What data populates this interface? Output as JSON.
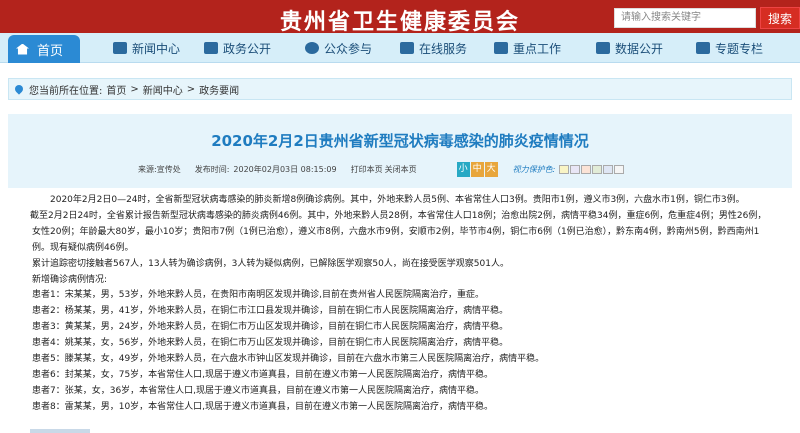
{
  "header": {
    "site_title": "贵州省卫生健康委员会",
    "search_placeholder": "请输入搜索关键字",
    "search_button": "搜索"
  },
  "nav": {
    "items": [
      {
        "label": "首页",
        "icon": "home-icon"
      },
      {
        "label": "新闻中心",
        "icon": "news-icon"
      },
      {
        "label": "政务公开",
        "icon": "briefcase-icon"
      },
      {
        "label": "公众参与",
        "icon": "chat-icon"
      },
      {
        "label": "在线服务",
        "icon": "monitor-icon"
      },
      {
        "label": "重点工作",
        "icon": "bookmark-icon"
      },
      {
        "label": "数据公开",
        "icon": "data-icon"
      },
      {
        "label": "专题专栏",
        "icon": "topic-icon"
      }
    ]
  },
  "breadcrumb": {
    "prefix": "您当前所在位置:",
    "items": [
      "首页",
      "新闻中心",
      "政务要闻"
    ],
    "separator": ">"
  },
  "article": {
    "title": "2020年2月2日贵州省新型冠状病毒感染的肺炎疫情情况",
    "source": "来源:宣传处",
    "published": "发布时间:",
    "published_value": "2020年02月03日 08:15:09",
    "print_label": "打印本页",
    "close_label": "关闭本页",
    "font_sizes": [
      "小",
      "中",
      "大"
    ],
    "font_size_colors": [
      "#28a9c4",
      "#e8a63c",
      "#e8a63c"
    ],
    "vision_label": "视力保护色:",
    "vision_colors": [
      "#f9f4c5",
      "#e9e6f6",
      "#fbe3d6",
      "#e2ecd7",
      "#dfe6f4",
      "#f5f5f5"
    ],
    "paragraphs": [
      "2020年2月2日0—24时，全省新型冠状病毒感染的肺炎新增8例确诊病例。其中，外地来黔人员5例、本省常住人口3例。贵阳市1例，遵义市3例，六盘水市1例，铜仁市3例。",
      "截至2月2日24时，全省累计报告新型冠状病毒感染的肺炎病例46例。其中，外地来黔人员28例，本省常住人口18例；治愈出院2例，病情平稳34例，重症6例，危重症4例；男性26例，女性20例；年龄最大80岁，最小10岁；贵阳市7例（1例已治愈），遵义市8例，六盘水市9例，安顺市2例，毕节市4例，铜仁市6例（1例已治愈），黔东南4例，黔南州5例，黔西南州1例。现有疑似病例46例。",
      "累计追踪密切接触者567人，13人转为确诊病例，3人转为疑似病例，已解除医学观察50人，尚在接受医学观察501人。",
      "新增确诊病例情况:",
      "患者1：宋某某，男，53岁，外地来黔人员，在贵阳市南明区发现并确诊,目前在贵州省人民医院隔离治疗，重症。",
      "患者2：杨某某，男，41岁，外地来黔人员，在铜仁市江口县发现并确诊，目前在铜仁市人民医院隔离治疗，病情平稳。",
      "患者3：黄某某，男，24岁，外地来黔人员，在铜仁市万山区发现并确诊，目前在铜仁市人民医院隔离治疗，病情平稳。",
      "患者4：姚某某，女，56岁，外地来黔人员，在铜仁市万山区发现并确诊，目前在铜仁市人民医院隔离治疗，病情平稳。",
      "患者5：滕某某，女，49岁，外地来黔人员，在六盘水市钟山区发现并确诊，目前在六盘水市第三人民医院隔离治疗，病情平稳。",
      "患者6：封某某，女，75岁，本省常住人口,现居于遵义市道真县，目前在遵义市第一人民医院隔离治疗，病情平稳。",
      "患者7：张某，女，36岁，本省常住人口,现居于遵义市道真县，目前在遵义市第一人民医院隔离治疗，病情平稳。",
      "患者8：雷某某，男，10岁，本省常住人口,现居于遵义市道真县，目前在遵义市第一人民医院隔离治疗，病情平稳。"
    ]
  },
  "colors": {
    "header_red": "#b3231c",
    "nav_bg": "#d6eef9",
    "accent_blue": "#2b8ad4",
    "title_blue": "#1f7cc0"
  }
}
